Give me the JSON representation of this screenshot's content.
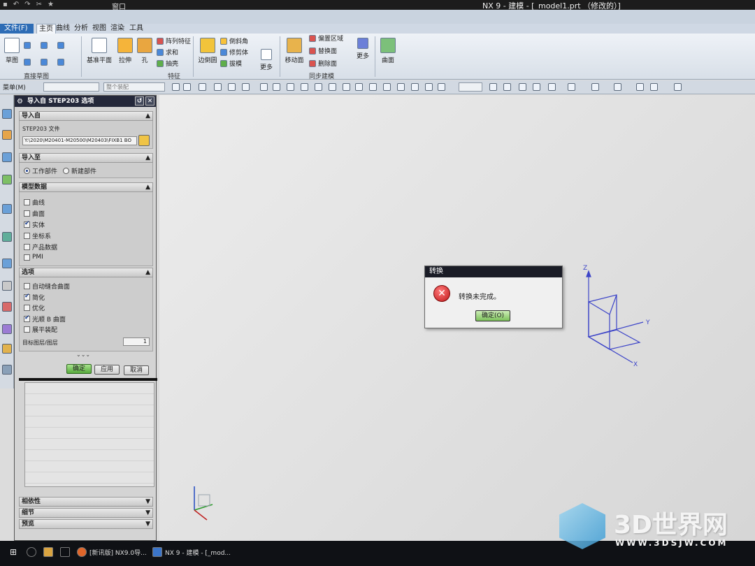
{
  "titlebar": {
    "window_menu": "窗口",
    "app_title": "NX 9 - 建模 - [_model1.prt （修改的）]"
  },
  "menu": {
    "file": "文件(F)",
    "tabs": [
      "主页",
      "曲线",
      "分析",
      "视图",
      "渲染",
      "工具"
    ]
  },
  "ribbon": {
    "sketch": "草图",
    "direct_sketch_group": "直接草图",
    "datum_plane": "基准平面",
    "extrude": "拉伸",
    "hole": "孔",
    "pattern_feature": "阵列特征",
    "unite": "求和",
    "shell": "抽壳",
    "feature_group": "特征",
    "edge_blend": "边倒圆",
    "chamfer": "倒斜角",
    "trim_body": "修剪体",
    "draft": "拔模",
    "more1": "更多",
    "move_face": "移动面",
    "offset_region": "偏置区域",
    "replace_face": "替换面",
    "delete_face": "删除面",
    "sync_group": "同步建模",
    "more2": "更多",
    "surface": "曲面"
  },
  "toolbar": {
    "menu": "菜单(M)",
    "filter_combo": "整个装配"
  },
  "import_dialog": {
    "title": "导入自 STEP203 选项",
    "section_import_from": "导入自",
    "step_file_label": "STEP203 文件",
    "file_path": "Y:\\2020\\M20401-M20500\\M20403\\FIXB1  BO",
    "section_import_to": "导入至",
    "radio_work_part": "工作部件",
    "radio_new_part": "新建部件",
    "section_model_data": "模型数据",
    "model_items": [
      {
        "label": "曲线",
        "checked": false
      },
      {
        "label": "曲面",
        "checked": false
      },
      {
        "label": "实体",
        "checked": true
      },
      {
        "label": "坐标系",
        "checked": false
      },
      {
        "label": "产品数据",
        "checked": false
      },
      {
        "label": "PMI",
        "checked": false
      }
    ],
    "section_options": "选项",
    "option_items": [
      {
        "label": "自动缝合曲面",
        "checked": false
      },
      {
        "label": "简化",
        "checked": true
      },
      {
        "label": "优化",
        "checked": false
      },
      {
        "label": "光顺 B 曲面",
        "checked": true
      },
      {
        "label": "展平装配",
        "checked": false
      }
    ],
    "layer_label": "目标图层/图层",
    "layer_value": "1",
    "ok": "确定",
    "apply": "应用",
    "cancel": "取消",
    "section_dependency": "相依性",
    "section_details": "细节",
    "section_preview": "预览"
  },
  "error_dialog": {
    "title": "转换",
    "message": "转换未完成。",
    "ok": "确定(O)"
  },
  "triad": {
    "z": "Z",
    "y": "Y",
    "x": "X"
  },
  "taskbar": {
    "item1": "[新讯版] NX9.0导...",
    "item2": "NX 9 - 建模 - [_mod..."
  },
  "watermark": {
    "brand": "3D世界网",
    "url": "WWW.3DSJW.COM"
  }
}
